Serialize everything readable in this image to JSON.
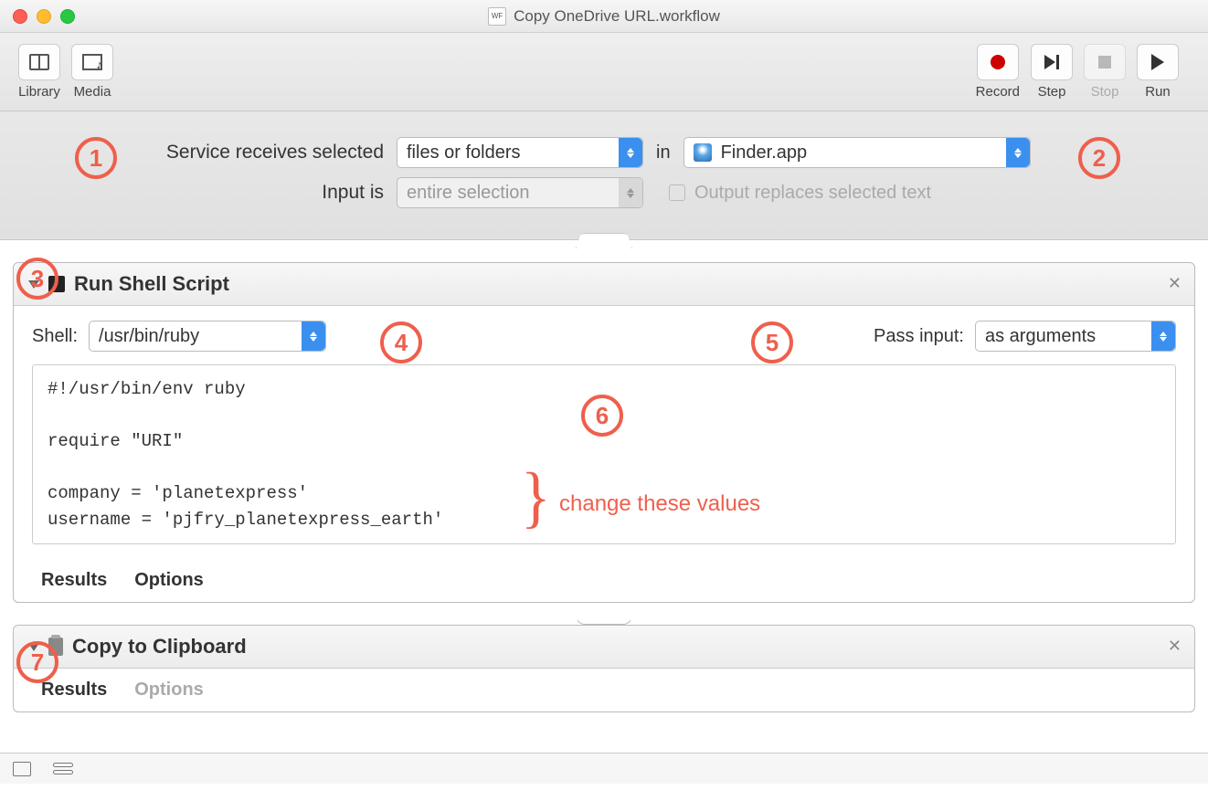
{
  "window": {
    "title": "Copy OneDrive URL.workflow"
  },
  "toolbar": {
    "library": "Library",
    "media": "Media",
    "record": "Record",
    "step": "Step",
    "stop": "Stop",
    "run": "Run"
  },
  "config": {
    "service_label": "Service receives selected",
    "type_value": "files or folders",
    "in_label": "in",
    "app_value": "Finder.app",
    "input_label": "Input is",
    "input_value": "entire selection",
    "output_label": "Output replaces selected text"
  },
  "action_shell": {
    "title": "Run Shell Script",
    "shell_label": "Shell:",
    "shell_value": "/usr/bin/ruby",
    "pass_label": "Pass input:",
    "pass_value": "as arguments",
    "script": "#!/usr/bin/env ruby\n\nrequire \"URI\"\n\ncompany = 'planetexpress'\nusername = 'pjfry_planetexpress_earth'",
    "results_label": "Results",
    "options_label": "Options"
  },
  "action_copy": {
    "title": "Copy to Clipboard",
    "results_label": "Results",
    "options_label": "Options"
  },
  "annotations": {
    "b1": "1",
    "b2": "2",
    "b3": "3",
    "b4": "4",
    "b5": "5",
    "b6": "6",
    "b7": "7",
    "change_text": "change these values"
  }
}
